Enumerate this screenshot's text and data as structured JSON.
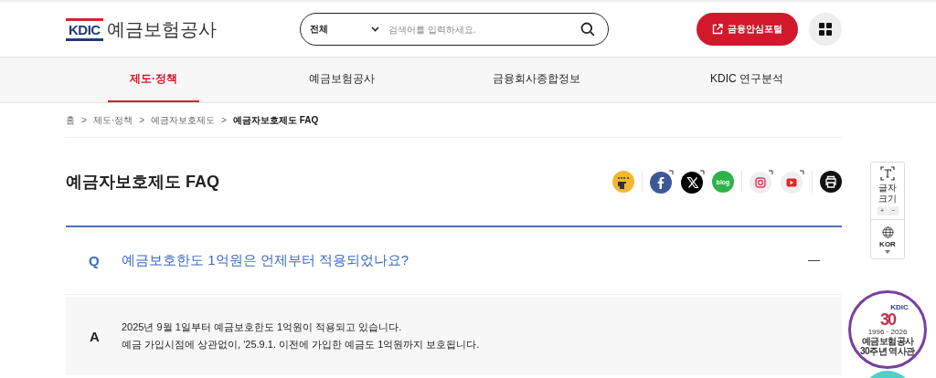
{
  "header": {
    "logo": {
      "mark": "KDIC",
      "name": "예금보험공사"
    },
    "search": {
      "scope": "전체",
      "placeholder": "검색어를 입력하세요."
    },
    "portal_button": "금융안심포털"
  },
  "nav": [
    {
      "label": "제도·정책",
      "selected": true
    },
    {
      "label": "예금보험공사",
      "selected": false
    },
    {
      "label": "금융회사종합정보",
      "selected": false
    },
    {
      "label": "KDIC 연구분석",
      "selected": false
    }
  ],
  "breadcrumb": [
    {
      "label": "홈",
      "current": false
    },
    {
      "separator": ">",
      "label": "제도·정책",
      "current": false
    },
    {
      "separator": ">",
      "label": "예금자보호제도",
      "current": false
    },
    {
      "separator": ">",
      "label": "예금자보호제도 FAQ",
      "current": true
    }
  ],
  "page_title": "예금자보호제도 FAQ",
  "share_icons": [
    {
      "kind": "sign"
    },
    {
      "kind": "facebook"
    },
    {
      "kind": "x"
    },
    {
      "kind": "blog",
      "text": "blog"
    },
    {
      "kind": "instagram"
    },
    {
      "kind": "youtube"
    },
    {
      "kind": "print"
    }
  ],
  "faq": [
    {
      "q_mark": "Q",
      "question": "예금보호한도 1억원은 언제부터 적용되었나요?",
      "expanded": true,
      "a_mark": "A",
      "answer": [
        "2025년 9월 1일부터 예금보호한도 1억원이 적용되고 있습니다.",
        "예금 가입시점에 상관없이, '25.9.1. 이전에 가입한 예금도 1억원까지 보호됩니다."
      ]
    }
  ],
  "side_tools": {
    "font_size": {
      "label": "글자 크기",
      "plus": "+",
      "minus": "−"
    },
    "language": "KOR"
  },
  "anniversary_badge": {
    "brand": "KDIC",
    "number": "30",
    "years": "1996 · 2026",
    "org": "예금보험공사",
    "caption": "30주년 역사관"
  }
}
